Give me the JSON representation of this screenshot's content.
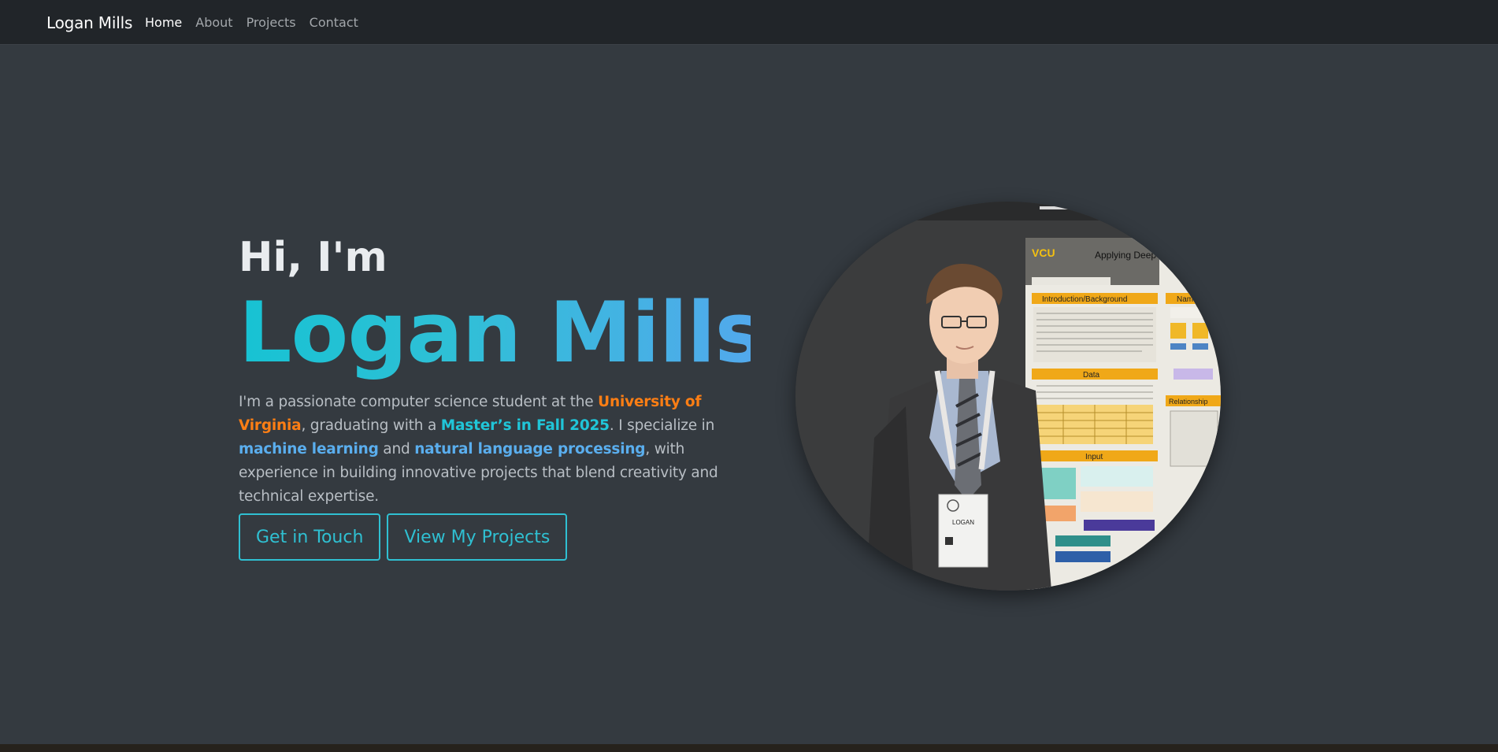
{
  "navbar": {
    "brand": "Logan Mills",
    "links": [
      {
        "label": "Home",
        "active": true
      },
      {
        "label": "About",
        "active": false
      },
      {
        "label": "Projects",
        "active": false
      },
      {
        "label": "Contact",
        "active": false
      }
    ]
  },
  "hero": {
    "greeting": "Hi, I'm",
    "name": "Logan Mills",
    "bio": {
      "p1": "I'm a passionate computer science student at the ",
      "university": "University of Virginia",
      "p2": ", graduating with a ",
      "degree": "Master’s in Fall 2025",
      "p3": ". I specialize in ",
      "skill1": "machine learning",
      "p4": " and ",
      "skill2": "natural language processing",
      "p5": ", with experience in building innovative projects that blend creativity and technical expertise."
    },
    "buttons": {
      "contact": "Get in Touch",
      "projects": "View My Projects"
    }
  },
  "portrait": {
    "poster_logo": "VCU",
    "poster_title": "Applying Deep",
    "sections": [
      "Introduction/Background",
      "Data",
      "Input",
      "Name",
      "Relationship"
    ],
    "badge_name": "LOGAN"
  },
  "colors": {
    "background": "#343a40",
    "navbar": "#212529",
    "accent_orange": "#fd7e14",
    "accent_cyan": "#20c5d8",
    "accent_blue": "#5aaeee"
  }
}
